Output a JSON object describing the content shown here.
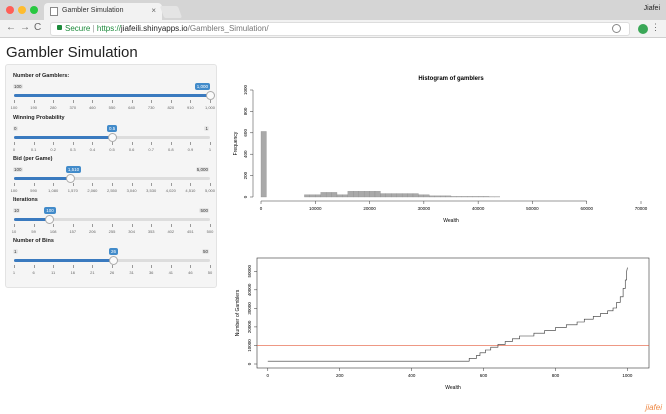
{
  "browser": {
    "tab_title": "Gambler Simulation",
    "tab_close": "×",
    "user": "Jiafei",
    "secure_label": "Secure",
    "url_prefix": "https://",
    "url_host": "jiafeili.shinyapps.io",
    "url_path": "/Gamblers_Simulation/",
    "back": "←",
    "forward": "→",
    "reload": "C",
    "menu": "⋮"
  },
  "page": {
    "title": "Gambler Simulation"
  },
  "controls": [
    {
      "label": "Number of Gamblers:",
      "min": "100",
      "max": "1,000",
      "value": "1,000",
      "fraction": 1.0,
      "ticks": [
        "100",
        "190",
        "280",
        "370",
        "460",
        "550",
        "640",
        "730",
        "820",
        "910",
        "1,000"
      ]
    },
    {
      "label": "Winning Probability",
      "min": "0",
      "max": "1",
      "value": "0.5",
      "fraction": 0.5,
      "ticks": [
        "0",
        "0.1",
        "0.2",
        "0.3",
        "0.4",
        "0.5",
        "0.6",
        "0.7",
        "0.8",
        "0.9",
        "1"
      ]
    },
    {
      "label": "Bid (per Game)",
      "min": "100",
      "max": "5,000",
      "value": "1,510",
      "fraction": 0.29,
      "ticks": [
        "100",
        "590",
        "1,080",
        "1,570",
        "2,060",
        "2,550",
        "3,040",
        "3,530",
        "4,020",
        "4,510",
        "5,000"
      ]
    },
    {
      "label": "Iterations",
      "min": "10",
      "max": "500",
      "value": "100",
      "fraction": 0.18,
      "ticks": [
        "10",
        "59",
        "108",
        "157",
        "206",
        "255",
        "304",
        "353",
        "402",
        "451",
        "500"
      ]
    },
    {
      "label": "Number of Bins",
      "min": "1",
      "max": "50",
      "value": "26",
      "fraction": 0.51,
      "ticks": [
        "1",
        "6",
        "11",
        "16",
        "21",
        "26",
        "31",
        "36",
        "41",
        "46",
        "50"
      ]
    }
  ],
  "chart_data": [
    {
      "type": "bar",
      "title": "Histogram of gamblers",
      "xlabel": "Wealth",
      "ylabel": "Frequency",
      "x_bin_edges": [
        0,
        2000,
        4000,
        6000,
        8000,
        10000,
        12000,
        14000,
        16000,
        18000,
        20000,
        22000,
        24000,
        26000,
        28000,
        30000,
        32000,
        34000,
        36000,
        38000,
        40000,
        42000,
        44000
      ],
      "values": [
        570,
        0,
        0,
        0,
        0,
        0,
        0,
        0,
        20,
        20,
        20,
        40,
        40,
        40,
        20,
        20,
        50,
        50,
        50,
        50,
        50,
        50,
        30,
        30,
        30,
        30,
        30,
        30,
        30,
        20,
        20,
        10,
        10,
        10,
        10,
        5,
        5,
        5,
        5,
        5,
        5,
        5,
        3,
        2
      ],
      "xlim": [
        0,
        40000
      ],
      "ylim": [
        0,
        1000
      ],
      "xticks": [
        "0",
        "10000",
        "20000",
        "30000",
        "40000",
        "50000",
        "60000",
        "70000"
      ],
      "yticks": [
        "0",
        "200",
        "400",
        "600",
        "800",
        "1000"
      ]
    },
    {
      "type": "line",
      "xlabel": "Wealth",
      "ylabel": "Number of Gamblers",
      "xticks": [
        "0",
        "200",
        "400",
        "600",
        "800",
        "1000"
      ],
      "yticks": [
        "0",
        "10000",
        "20000",
        "30000",
        "40000",
        "50000"
      ],
      "xlim": [
        0,
        1030
      ],
      "ylim": [
        0,
        55000
      ],
      "reference_line_y": 10000,
      "series": [
        {
          "points": [
            [
              0,
              1510
            ],
            [
              560,
              1510
            ],
            [
              560,
              3020
            ],
            [
              580,
              3020
            ],
            [
              580,
              4530
            ],
            [
              590,
              4530
            ],
            [
              590,
              6040
            ],
            [
              605,
              6040
            ],
            [
              605,
              7550
            ],
            [
              620,
              7550
            ],
            [
              620,
              9060
            ],
            [
              640,
              9060
            ],
            [
              640,
              10570
            ],
            [
              660,
              10570
            ],
            [
              660,
              12080
            ],
            [
              680,
              12080
            ],
            [
              680,
              13590
            ],
            [
              700,
              13590
            ],
            [
              700,
              15100
            ],
            [
              740,
              15100
            ],
            [
              740,
              16610
            ],
            [
              770,
              16610
            ],
            [
              770,
              18120
            ],
            [
              800,
              18120
            ],
            [
              800,
              19630
            ],
            [
              830,
              19630
            ],
            [
              830,
              21140
            ],
            [
              860,
              21140
            ],
            [
              860,
              22650
            ],
            [
              880,
              22650
            ],
            [
              880,
              24160
            ],
            [
              905,
              24160
            ],
            [
              905,
              25670
            ],
            [
              925,
              25670
            ],
            [
              925,
              27180
            ],
            [
              945,
              27180
            ],
            [
              945,
              28690
            ],
            [
              960,
              28690
            ],
            [
              960,
              30200
            ],
            [
              970,
              30200
            ],
            [
              970,
              33220
            ],
            [
              980,
              33220
            ],
            [
              980,
              36240
            ],
            [
              988,
              36240
            ],
            [
              988,
              40770
            ],
            [
              994,
              40770
            ],
            [
              994,
              45300
            ],
            [
              998,
              45300
            ],
            [
              998,
              50000
            ],
            [
              1000,
              52000
            ]
          ]
        }
      ]
    }
  ],
  "watermark": "jiafei",
  "colors": {
    "accent": "#428bca",
    "bar": "#a9a9a9",
    "refline": "#e35a3a"
  }
}
